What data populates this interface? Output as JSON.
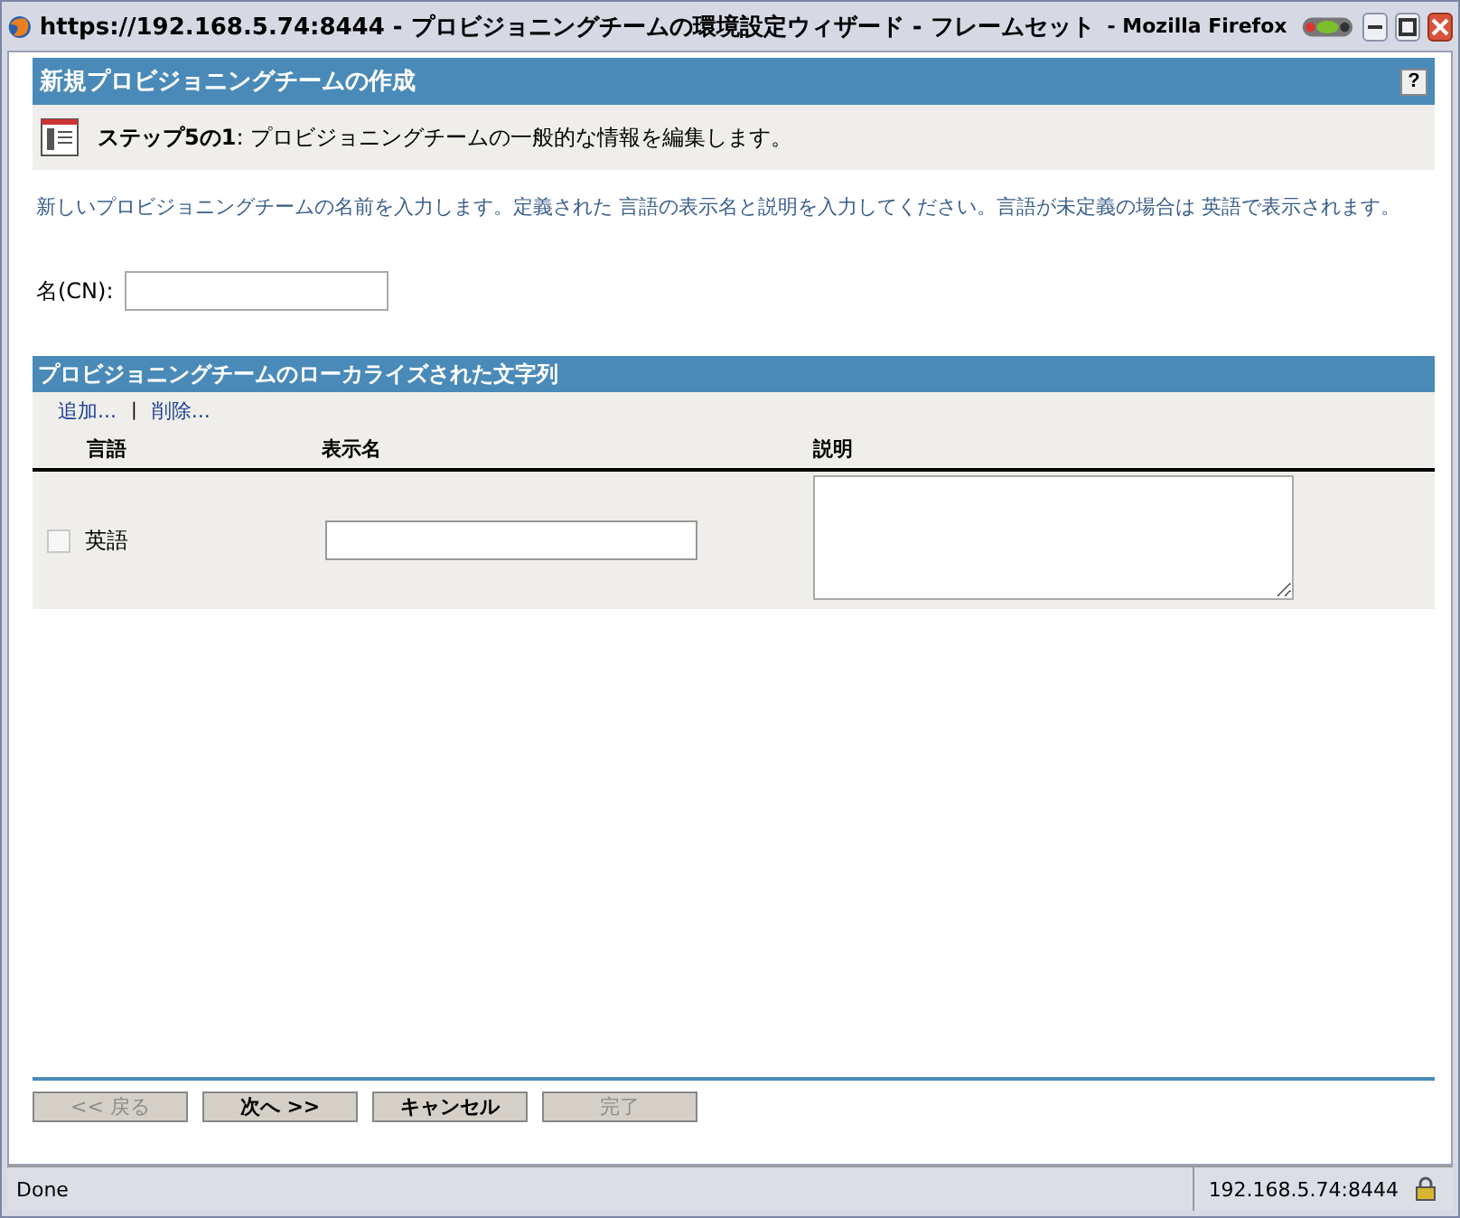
{
  "window": {
    "title": "https://192.168.5.74:8444 - プロビジョニングチームの環境設定ウィザード - フレームセット",
    "app": "- Mozilla Firefox"
  },
  "header": {
    "title": "新規プロビジョニングチームの作成",
    "help": "?"
  },
  "step": {
    "label": "ステップ5の1",
    "text": ": プロビジョニングチームの一般的な情報を編集します。"
  },
  "intro": "新しいプロビジョニングチームの名前を入力します。定義された 言語の表示名と説明を入力してください。言語が未定義の場合は 英語で表示されます。",
  "name_field": {
    "label": "名(CN):"
  },
  "strings": {
    "title": "プロビジョニングチームのローカライズされた文字列",
    "actions": [
      "追加...",
      "削除..."
    ],
    "separator": "|",
    "columns": [
      "言語",
      "表示名",
      "説明"
    ],
    "rows": [
      {
        "language": "英語",
        "checked": false
      }
    ]
  },
  "buttons": [
    {
      "label": "<< 戻る",
      "disabled": true
    },
    {
      "label": "次へ >>",
      "disabled": false
    },
    {
      "label": "キャンセル",
      "disabled": false
    },
    {
      "label": "完了",
      "disabled": true
    }
  ],
  "status_bar": {
    "text": "Done",
    "host": "192.168.5.74:8444"
  }
}
